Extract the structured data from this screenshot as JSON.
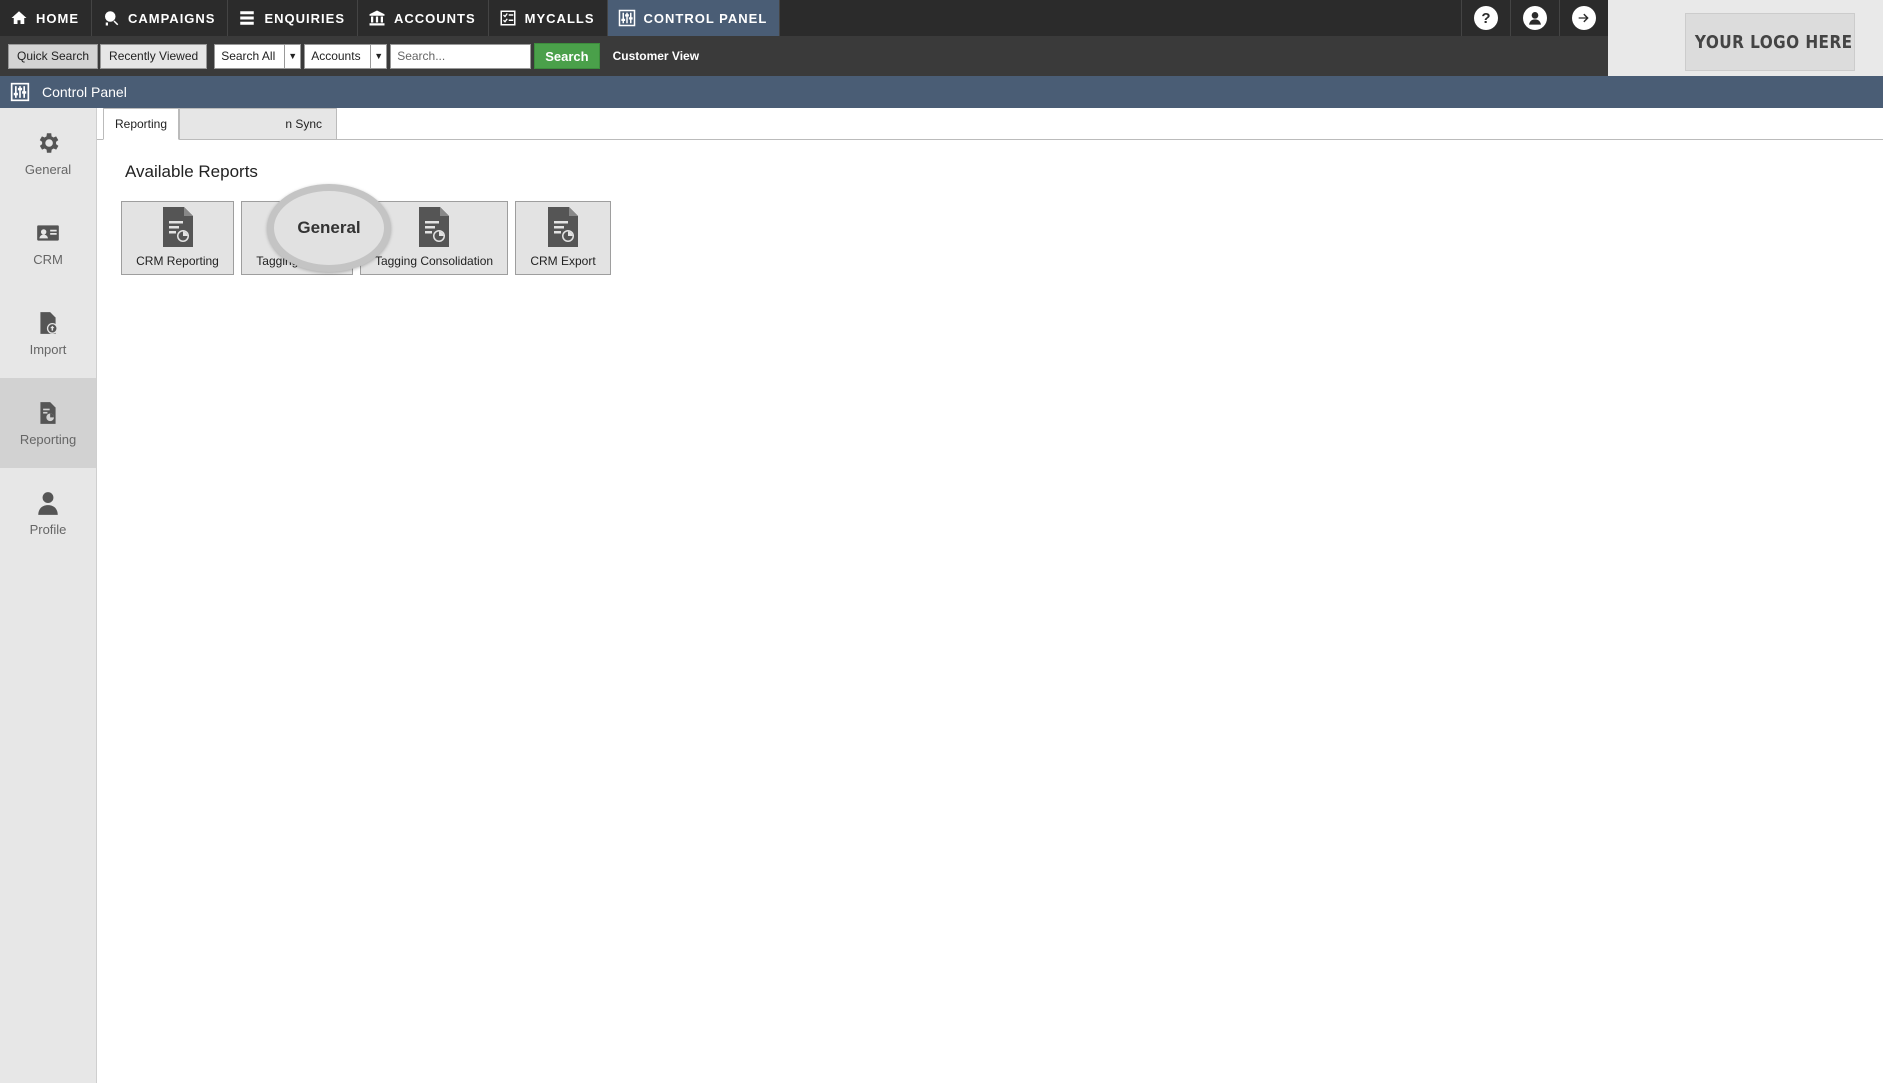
{
  "topnav": {
    "items": [
      {
        "label": "HOME",
        "icon": "home-icon"
      },
      {
        "label": "CAMPAIGNS",
        "icon": "campaigns-icon"
      },
      {
        "label": "ENQUIRIES",
        "icon": "enquiries-icon"
      },
      {
        "label": "ACCOUNTS",
        "icon": "accounts-icon"
      },
      {
        "label": "MYCALLS",
        "icon": "mycalls-icon"
      },
      {
        "label": "CONTROL PANEL",
        "icon": "control-panel-icon",
        "active": true
      }
    ],
    "right_icons": [
      "help-icon",
      "user-icon",
      "logout-icon"
    ],
    "help_glyph": "?"
  },
  "searchbar": {
    "quick_search": "Quick Search",
    "recently_viewed": "Recently Viewed",
    "scope_select": "Search All",
    "entity_select": "Accounts",
    "search_placeholder": "Search...",
    "search_button": "Search",
    "customer_view": "Customer View",
    "arrow": "▼"
  },
  "logo": {
    "text": "YOUR LOGO HERE"
  },
  "header": {
    "title": "Control Panel"
  },
  "sidebar": {
    "items": [
      {
        "label": "General",
        "icon": "gear-icon"
      },
      {
        "label": "CRM",
        "icon": "crm-card-icon"
      },
      {
        "label": "Import",
        "icon": "import-icon"
      },
      {
        "label": "Reporting",
        "icon": "reporting-icon",
        "active": true
      },
      {
        "label": "Profile",
        "icon": "profile-icon"
      }
    ]
  },
  "tabs": {
    "reporting": "Reporting",
    "data_sync_partial": "n Sync"
  },
  "magnifier": {
    "label": "General"
  },
  "reports": {
    "title": "Available Reports",
    "buttons": [
      {
        "label": "CRM Reporting"
      },
      {
        "label": "Tagging Report"
      },
      {
        "label": "Tagging Consolidation"
      },
      {
        "label": "CRM Export"
      }
    ]
  },
  "colors": {
    "nav_bg": "#2b2b2b",
    "accent": "#4a5d75",
    "search_green": "#4aa04a",
    "sidebar_bg": "#e7e7e7"
  }
}
